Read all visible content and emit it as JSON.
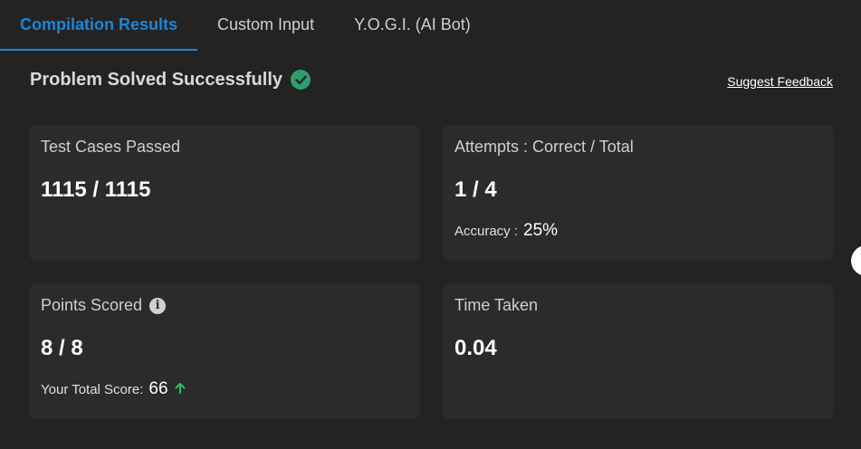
{
  "tabs": [
    {
      "label": "Compilation Results",
      "active": true
    },
    {
      "label": "Custom Input",
      "active": false
    },
    {
      "label": "Y.O.G.I. (AI Bot)",
      "active": false
    }
  ],
  "status": {
    "title": "Problem Solved Successfully",
    "icon": "check-circle-icon",
    "color": "#2f9e6e"
  },
  "feedback_link": "Suggest Feedback",
  "cards": {
    "test_cases": {
      "label": "Test Cases Passed",
      "value": "1115 / 1115"
    },
    "attempts": {
      "label": "Attempts : Correct / Total",
      "value": "1 / 4",
      "accuracy_label": "Accuracy :",
      "accuracy_value": "25%"
    },
    "points": {
      "label": "Points Scored",
      "info_icon": "info-icon",
      "value": "8 / 8",
      "total_label": "Your Total Score:",
      "total_value": "66",
      "trend_icon": "arrow-up-icon",
      "trend_color": "#22c55e"
    },
    "time": {
      "label": "Time Taken",
      "value": "0.04"
    }
  },
  "accent_color": "#1a86d8"
}
